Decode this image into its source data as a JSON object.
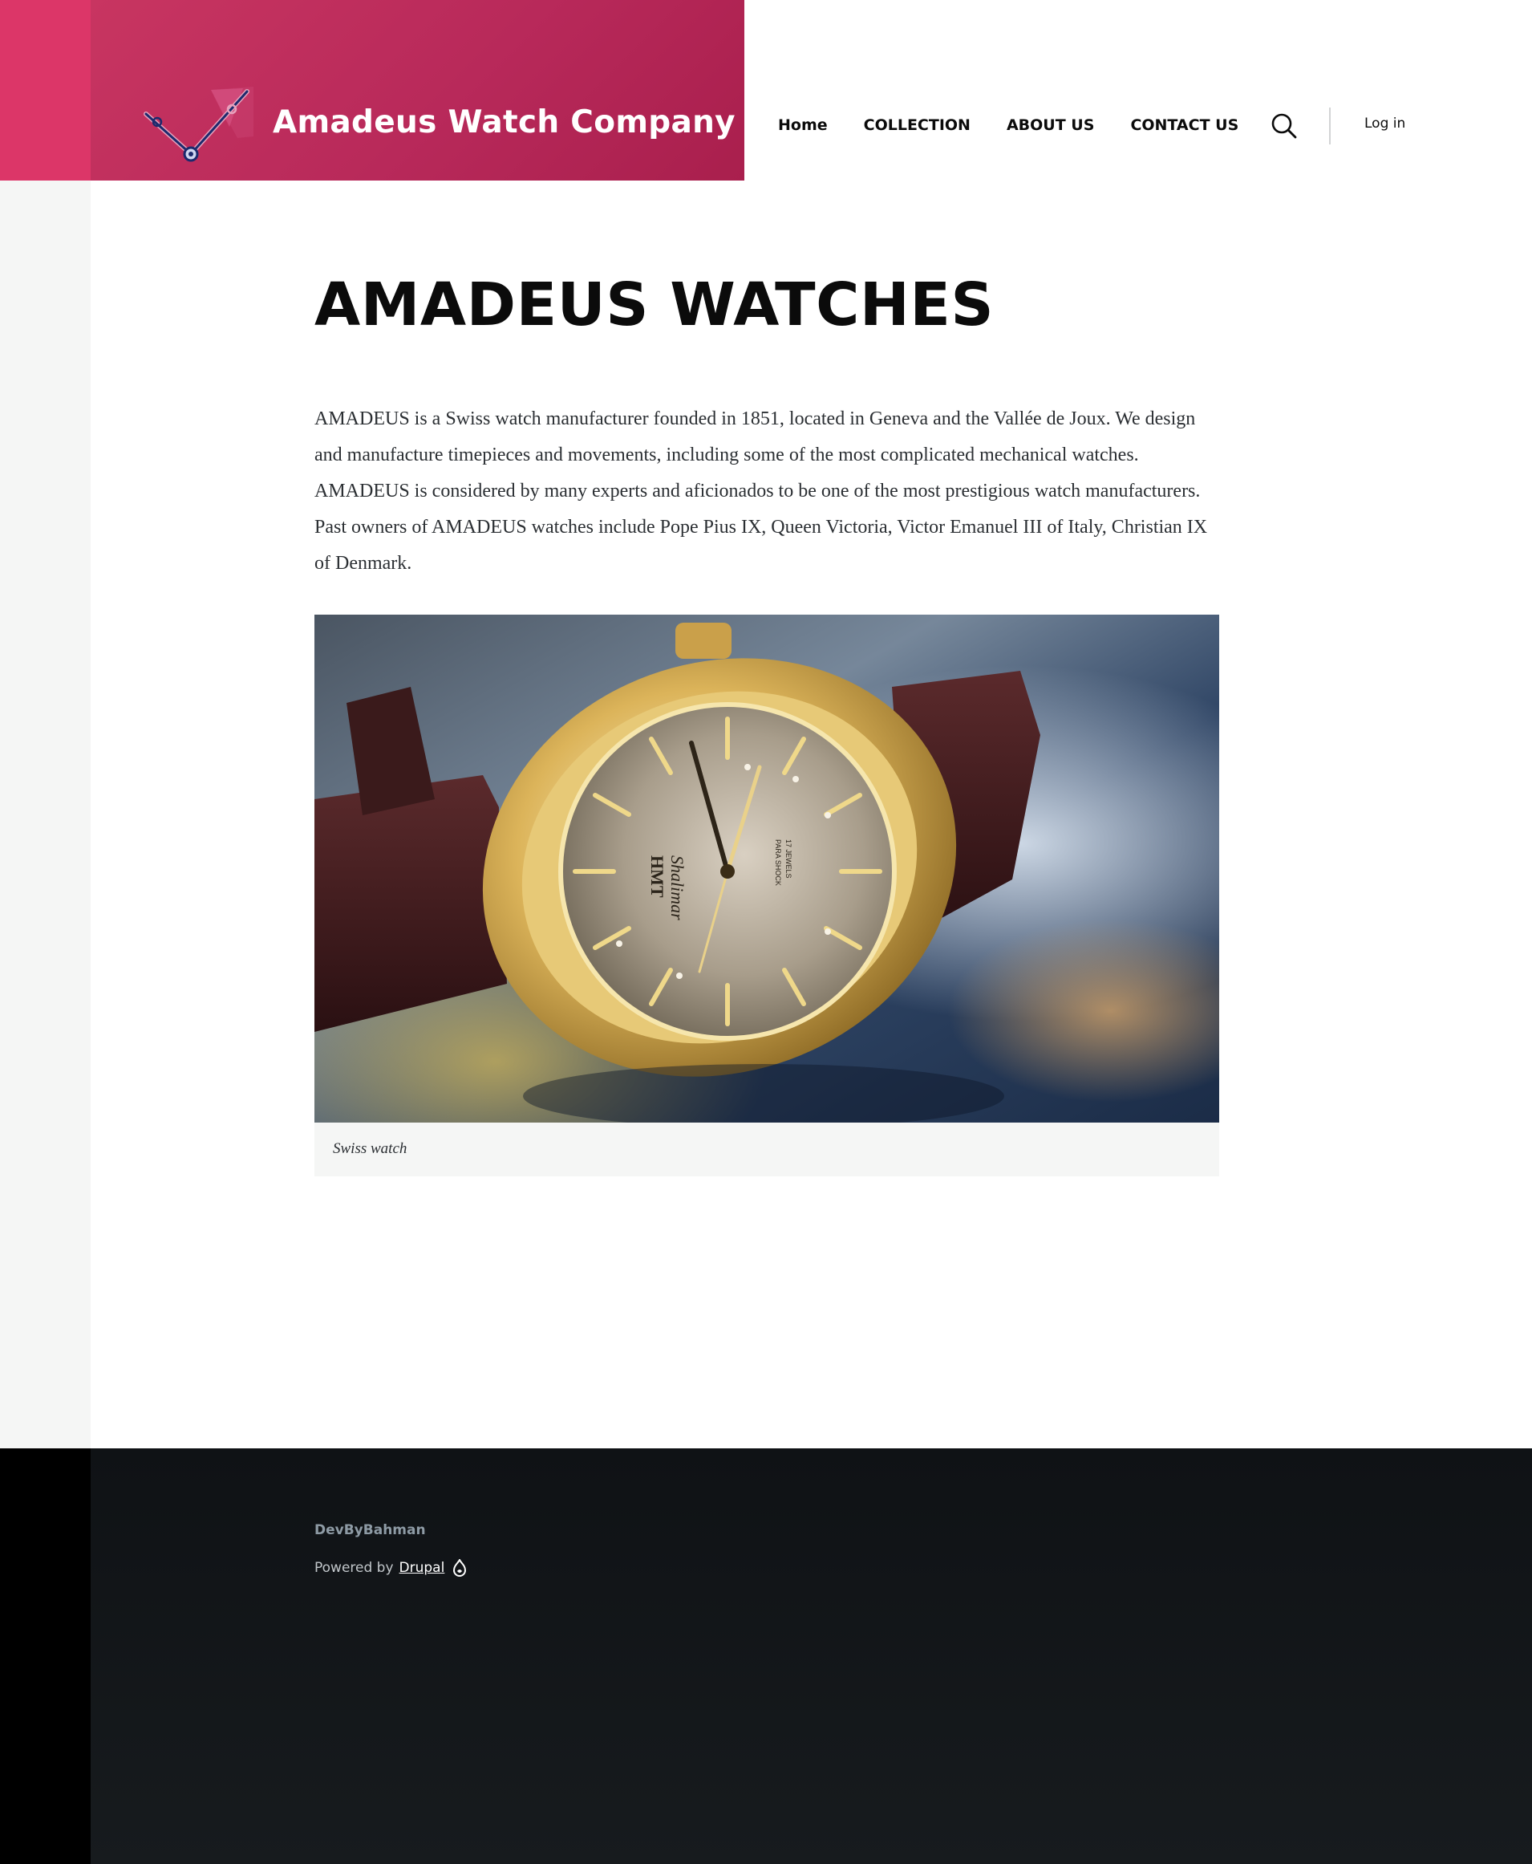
{
  "site": {
    "name": "Amadeus Watch Company",
    "logo_icon": "watch-hands-logo",
    "brand_color": "#dc3668"
  },
  "nav": {
    "items": [
      {
        "label": "Home"
      },
      {
        "label": "COLLECTION"
      },
      {
        "label": "ABOUT US"
      },
      {
        "label": "CONTACT US"
      }
    ],
    "search_icon": "search-icon",
    "login_label": "Log in"
  },
  "main": {
    "title": "AMADEUS WATCHES",
    "body": "AMADEUS is a Swiss watch manufacturer founded in 1851, located in Geneva and the Vallée de Joux. We design and manufacture timepieces and movements, including some of the most complicated mechanical watches. AMADEUS is considered by many experts and aficionados to be one of the most prestigious watch manufacturers. Past owners of AMADEUS watches include Pope Pius IX, Queen Victoria, Victor Emanuel III of Italy, Christian IX of Denmark.",
    "image": {
      "subject": "gold wristwatch on brown leather strap",
      "dial_text": {
        "brand": "HMT",
        "model": "Shalimar",
        "line1": "PARA SHOCK",
        "line2": "17 JEWELS"
      },
      "caption": "Swiss watch"
    }
  },
  "footer": {
    "brand": "DevByBahman",
    "powered_prefix": "Powered by",
    "powered_link": "Drupal",
    "drupal_icon": "drupal-drop-icon"
  }
}
